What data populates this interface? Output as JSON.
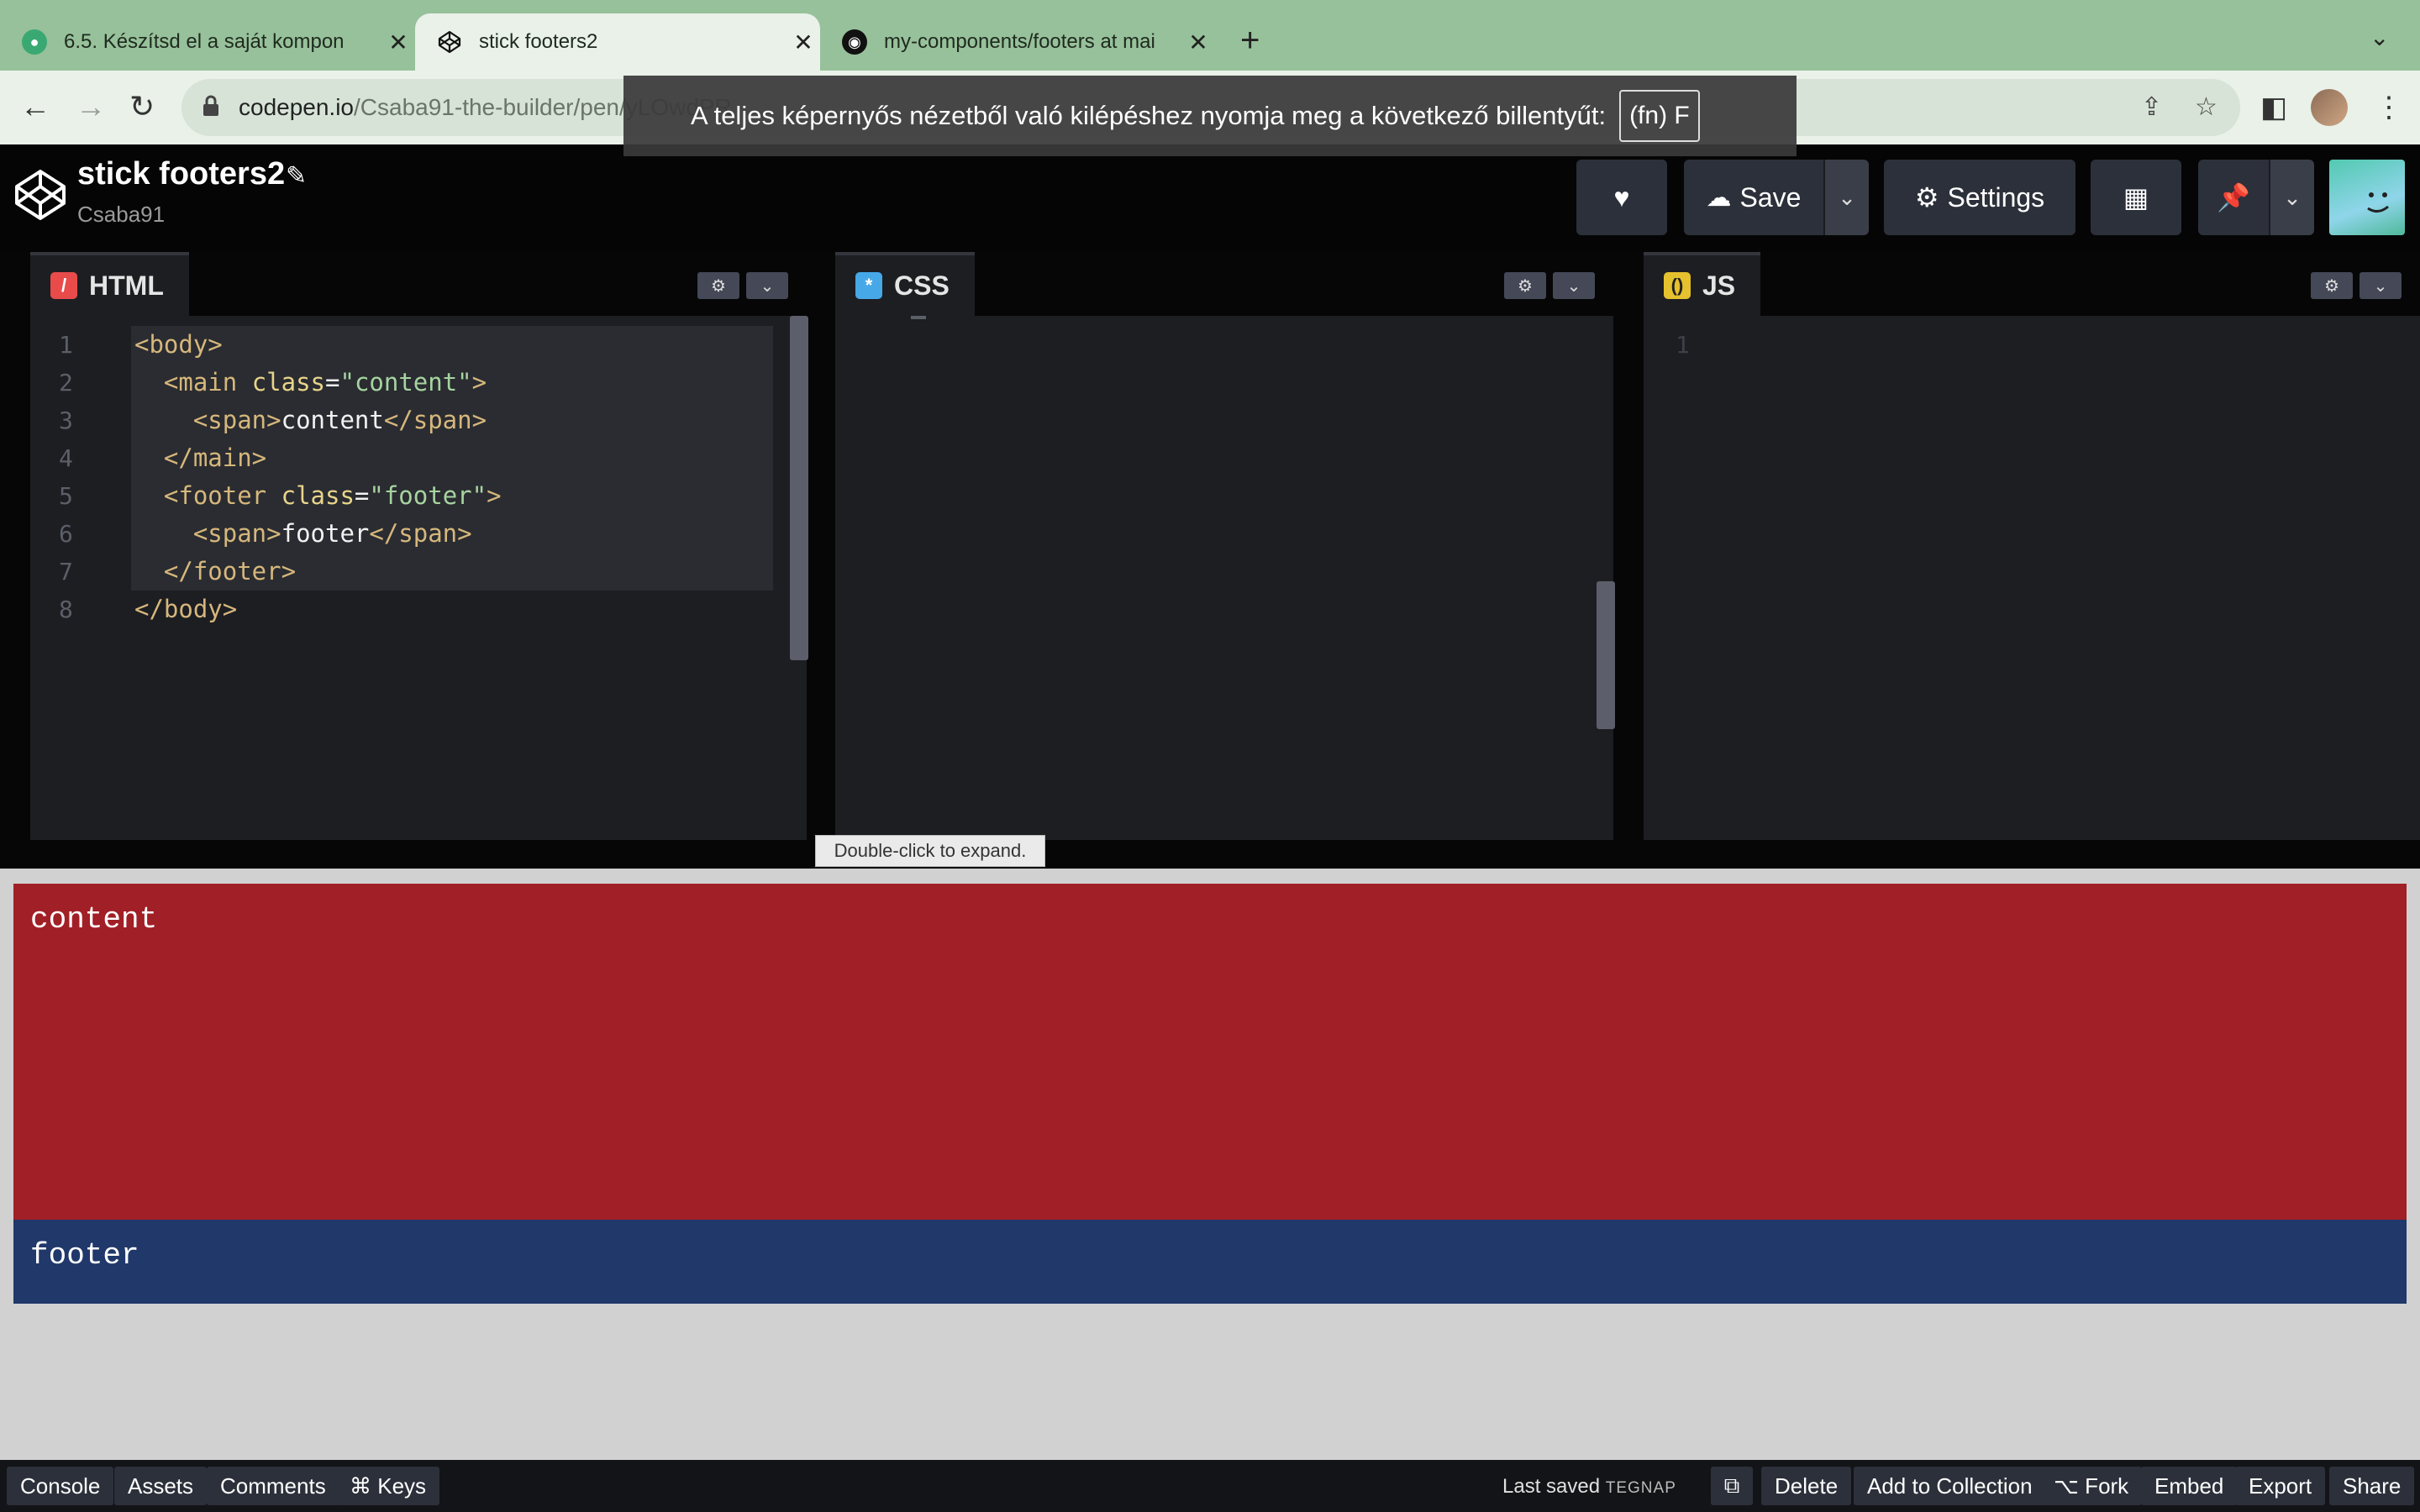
{
  "browser": {
    "tabs": [
      {
        "title": "6.5. Készítsd el a saját kompon",
        "icon": "site-favicon"
      },
      {
        "title": "stick footers2",
        "icon": "codepen-favicon"
      },
      {
        "title": "my-components/footers at mai",
        "icon": "github-icon"
      }
    ],
    "new_tab": "+",
    "url_host": "codepen.io",
    "url_path": "/Csaba91-the-builder/pen/yLOwdPR",
    "fullscreen_toast": "A teljes képernyős nézetből való kilépéshez nyomja meg a következő billentyűt:",
    "fullscreen_key": "(fn) F"
  },
  "codepen": {
    "pen_title": "stick footers2",
    "author": "Csaba91",
    "buttons": {
      "save": "Save",
      "settings": "Settings"
    }
  },
  "editors": {
    "html": {
      "label": "HTML",
      "line_numbers": [
        "1",
        "2",
        "3",
        "4",
        "5",
        "6",
        "7",
        "8"
      ]
    },
    "css": {
      "label": "CSS"
    },
    "js": {
      "label": "JS",
      "line_numbers": [
        "1"
      ]
    }
  },
  "tooltip": "Double-click to expand.",
  "preview": {
    "content_text": "content",
    "footer_text": "footer",
    "colors": {
      "content": "#a11f26",
      "footer": "#20386a",
      "background": "#d1d1d1"
    }
  },
  "bottom_bar": {
    "console": "Console",
    "assets": "Assets",
    "comments": "Comments",
    "keys": "⌘ Keys",
    "last_saved": "Last saved",
    "last_saved_when": "TEGNAP",
    "delete": "Delete",
    "add_to_collection": "Add to Collection",
    "fork": "⌥ Fork",
    "embed": "Embed",
    "export": "Export",
    "share": "Share"
  }
}
